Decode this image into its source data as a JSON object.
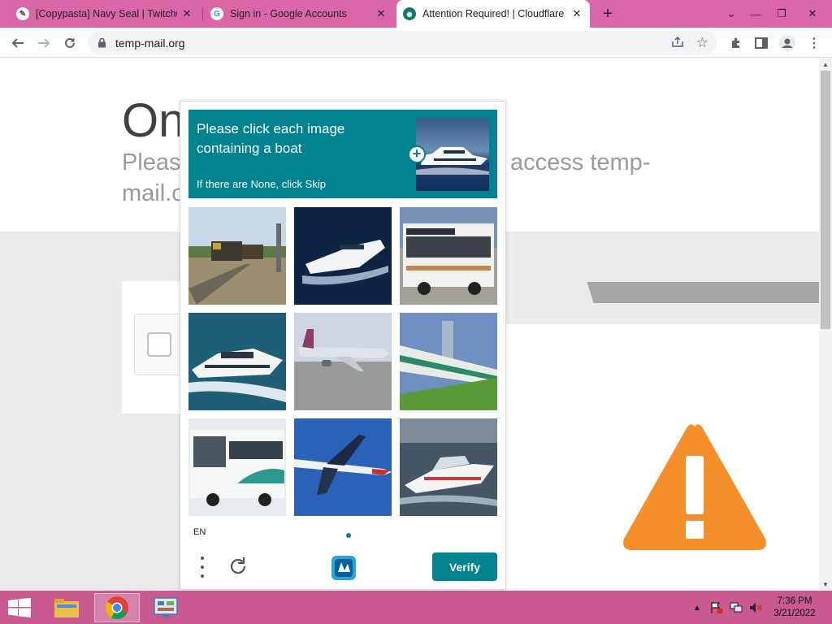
{
  "browser": {
    "tabs": [
      {
        "title": "[Copypasta] Navy Seal | TwitchQ",
        "icon": "twitch-quotes-favicon",
        "active": false
      },
      {
        "title": "Sign in - Google Accounts",
        "icon": "google-favicon",
        "active": false
      },
      {
        "title": "Attention Required! | Cloudflare",
        "icon": "cloudflare-favicon",
        "active": true
      }
    ],
    "new_tab_label": "+",
    "url": "temp-mail.org",
    "colors": {
      "frame": "#d966a6",
      "accent": "#00838f"
    }
  },
  "page": {
    "title_visible": "On",
    "subtitle_left": "Please",
    "subtitle_right": "access temp-",
    "subtitle_line2": "mail.o"
  },
  "captcha": {
    "prompt_line": "Please click each image containing a boat",
    "prompt_hint": "If there are None, click Skip",
    "example_icon": "yacht-example-image",
    "images": [
      {
        "subject": "freight-train"
      },
      {
        "subject": "speedboat"
      },
      {
        "subject": "city-bus"
      },
      {
        "subject": "yacht"
      },
      {
        "subject": "airplane-on-runway"
      },
      {
        "subject": "passenger-train"
      },
      {
        "subject": "white-bus"
      },
      {
        "subject": "airplane-in-flight"
      },
      {
        "subject": "motorboat"
      }
    ],
    "language": "EN",
    "verify_label": "Verify"
  },
  "taskbar": {
    "apps": [
      "file-explorer-icon",
      "chrome-icon",
      "control-panel-icon"
    ],
    "time": "7:36 PM",
    "date": "3/21/2022"
  }
}
